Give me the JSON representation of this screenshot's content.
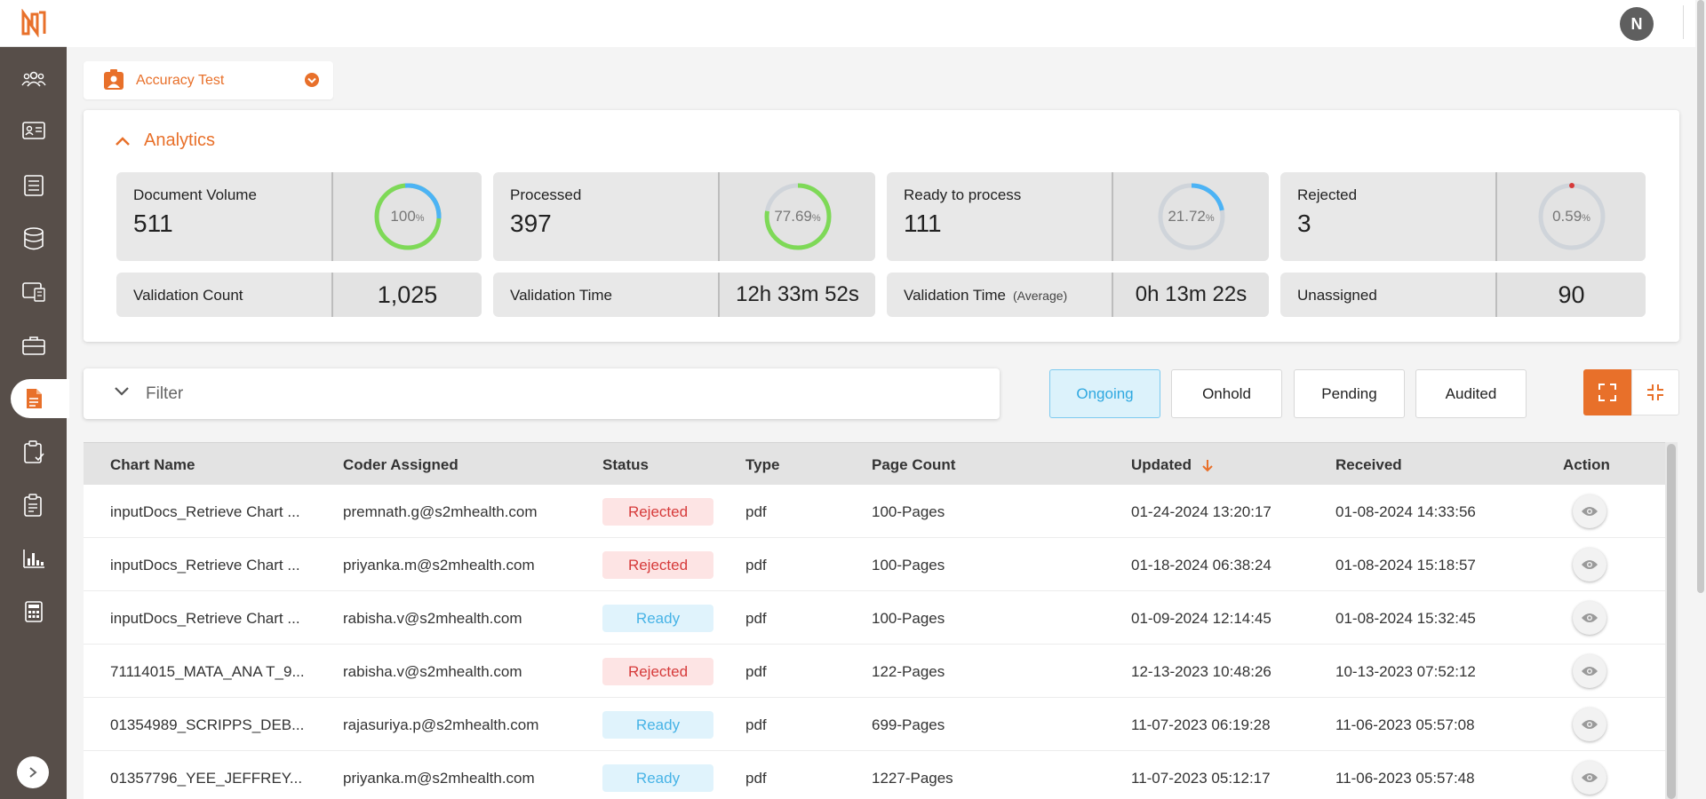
{
  "app": {
    "logo_letter": "N",
    "user_initial": "N"
  },
  "colors": {
    "accent": "#e8702a",
    "sidebar": "#574e49",
    "ready": "#47b3e6",
    "rejected": "#d63a3a",
    "gauge_green": "#7ed957",
    "gauge_blue": "#4cb3f5",
    "gauge_track": "#cfd4da"
  },
  "sidebar": {
    "items": [
      {
        "icon": "users-icon"
      },
      {
        "icon": "id-card-icon"
      },
      {
        "icon": "list-icon"
      },
      {
        "icon": "database-icon"
      },
      {
        "icon": "screen-icon"
      },
      {
        "icon": "briefcase-icon"
      },
      {
        "icon": "document-icon",
        "active": true
      },
      {
        "icon": "clipboard-check-icon"
      },
      {
        "icon": "clipboard-list-icon"
      },
      {
        "icon": "bar-chart-icon"
      },
      {
        "icon": "calculator-icon"
      }
    ]
  },
  "project": {
    "name": "Accuracy Test"
  },
  "analytics": {
    "title": "Analytics",
    "cards": [
      {
        "label": "Document Volume",
        "value": "511",
        "percent": "100",
        "percent_unit": "%",
        "fraction": 1.0
      },
      {
        "label": "Processed",
        "value": "397",
        "percent": "77.69",
        "percent_unit": "%",
        "fraction": 0.7769
      },
      {
        "label": "Ready to process",
        "value": "111",
        "percent": "21.72",
        "percent_unit": "%",
        "fraction": 0.2172
      },
      {
        "label": "Rejected",
        "value": "3",
        "percent": "0.59",
        "percent_unit": "%",
        "fraction": 0.0059
      }
    ],
    "metrics": [
      {
        "label": "Validation Count",
        "sub": "",
        "value": "1,025"
      },
      {
        "label": "Validation Time",
        "sub": "",
        "value": "12h 33m 52s"
      },
      {
        "label": "Validation Time",
        "sub": "(Average)",
        "value": "0h 13m 22s"
      },
      {
        "label": "Unassigned",
        "sub": "",
        "value": "90"
      }
    ]
  },
  "filter": {
    "label": "Filter"
  },
  "tabs": [
    {
      "label": "Ongoing",
      "active": true
    },
    {
      "label": "Onhold"
    },
    {
      "label": "Pending"
    },
    {
      "label": "Audited"
    }
  ],
  "table": {
    "columns": [
      "Chart Name",
      "Coder Assigned",
      "Status",
      "Type",
      "Page Count",
      "Updated",
      "Received",
      "Action"
    ],
    "rows": [
      {
        "chart": "inputDocs_Retrieve Chart ...",
        "coder": "premnath.g@s2mhealth.com",
        "status": "Rejected",
        "type": "pdf",
        "pages": "100-Pages",
        "updated": "01-24-2024 13:20:17",
        "received": "01-08-2024 14:33:56"
      },
      {
        "chart": "inputDocs_Retrieve Chart ...",
        "coder": "priyanka.m@s2mhealth.com",
        "status": "Rejected",
        "type": "pdf",
        "pages": "100-Pages",
        "updated": "01-18-2024 06:38:24",
        "received": "01-08-2024 15:18:57"
      },
      {
        "chart": "inputDocs_Retrieve Chart ...",
        "coder": "rabisha.v@s2mhealth.com",
        "status": "Ready",
        "type": "pdf",
        "pages": "100-Pages",
        "updated": "01-09-2024 12:14:45",
        "received": "01-08-2024 15:32:45"
      },
      {
        "chart": "71114015_MATA_ANA T_9...",
        "coder": "rabisha.v@s2mhealth.com",
        "status": "Rejected",
        "type": "pdf",
        "pages": "122-Pages",
        "updated": "12-13-2023 10:48:26",
        "received": "10-13-2023 07:52:12"
      },
      {
        "chart": "01354989_SCRIPPS_DEB...",
        "coder": "rajasuriya.p@s2mhealth.com",
        "status": "Ready",
        "type": "pdf",
        "pages": "699-Pages",
        "updated": "11-07-2023 06:19:28",
        "received": "11-06-2023 05:57:08"
      },
      {
        "chart": "01357796_YEE_JEFFREY...",
        "coder": "priyanka.m@s2mhealth.com",
        "status": "Ready",
        "type": "pdf",
        "pages": "1227-Pages",
        "updated": "11-07-2023 05:12:17",
        "received": "11-06-2023 05:57:48"
      }
    ]
  }
}
